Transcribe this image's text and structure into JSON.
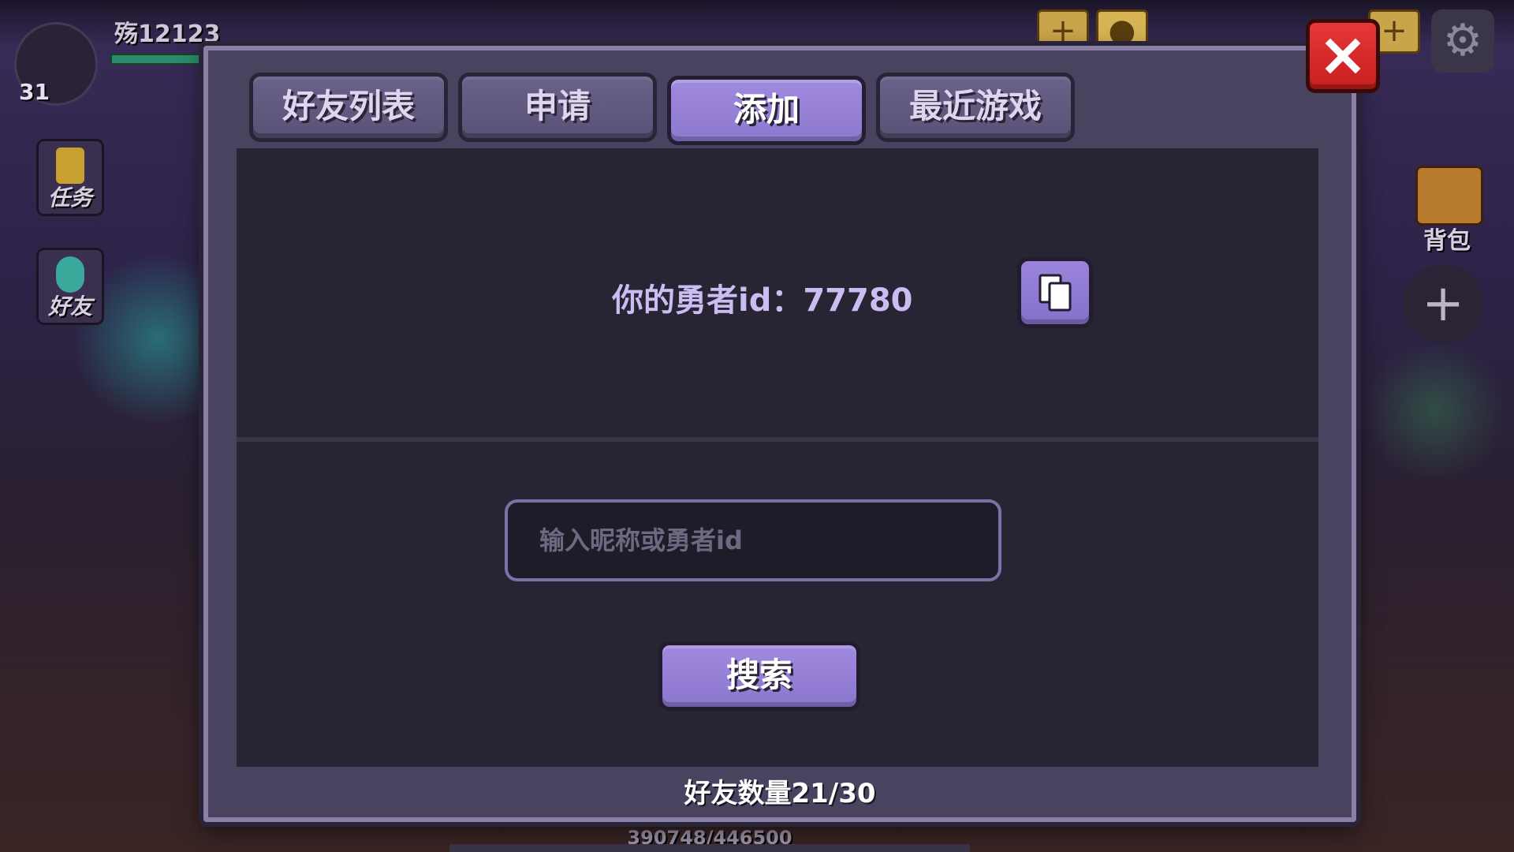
{
  "hud": {
    "player_name": "殇12123",
    "level": "31",
    "side_buttons": [
      {
        "label": "任务",
        "icon": "quest-icon"
      },
      {
        "label": "好友",
        "icon": "friends-icon"
      }
    ],
    "bag_label": "背包",
    "xp_text": "390748/446500"
  },
  "dialog": {
    "tabs": [
      {
        "label": "好友列表",
        "active": false
      },
      {
        "label": "申请",
        "active": false
      },
      {
        "label": "添加",
        "active": true
      },
      {
        "label": "最近游戏",
        "active": false
      }
    ],
    "id_label": "你的勇者id：77780",
    "search": {
      "placeholder": "输入昵称或勇者id",
      "value": ""
    },
    "search_button_label": "搜索",
    "friend_count": "好友数量21/30"
  },
  "colors": {
    "accent": "#8c78cc",
    "tab_inactive": "#5a5276",
    "close_red": "#d52828",
    "panel_bg": "#272433",
    "dialog_bg": "#4a4360"
  }
}
